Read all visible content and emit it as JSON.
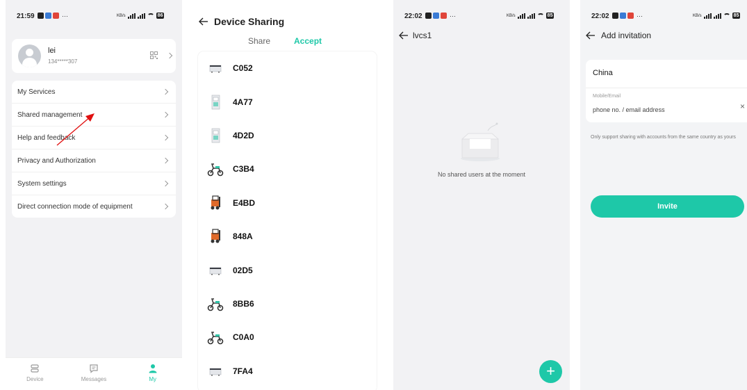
{
  "screen1": {
    "status": {
      "time": "21:59",
      "right_info": "79.8 KB/s",
      "battery": "86"
    },
    "profile": {
      "name": "lei",
      "phone": "134*****307"
    },
    "menu": [
      {
        "label": "My Services"
      },
      {
        "label": "Shared management"
      },
      {
        "label": "Help and feedback"
      },
      {
        "label": "Privacy and Authorization"
      },
      {
        "label": "System settings"
      },
      {
        "label": "Direct connection mode of equipment"
      }
    ],
    "tabs": [
      {
        "label": "Device",
        "icon": "device-icon"
      },
      {
        "label": "Messages",
        "icon": "message-icon"
      },
      {
        "label": "My",
        "icon": "person-icon"
      }
    ],
    "accent": "#1ec8a8",
    "annotation_color": "#e01010"
  },
  "screen2": {
    "title": "Device Sharing",
    "tabs": {
      "share": "Share",
      "accept": "Accept"
    },
    "devices": [
      {
        "name": "C052",
        "icon": "battery-unit-icon"
      },
      {
        "name": "4A77",
        "icon": "charging-cabinet-icon"
      },
      {
        "name": "4D2D",
        "icon": "charging-cabinet-icon"
      },
      {
        "name": "C3B4",
        "icon": "scooter-icon"
      },
      {
        "name": "E4BD",
        "icon": "forklift-icon"
      },
      {
        "name": "848A",
        "icon": "forklift-icon"
      },
      {
        "name": "02D5",
        "icon": "battery-unit-icon"
      },
      {
        "name": "8BB6",
        "icon": "scooter-icon"
      },
      {
        "name": "C0A0",
        "icon": "scooter-icon"
      },
      {
        "name": "7FA4",
        "icon": "battery-unit-icon"
      }
    ]
  },
  "screen3": {
    "status": {
      "time": "22:02",
      "battery": "85"
    },
    "title": "lvcs1",
    "empty_text": "No shared users at the moment",
    "fab_label": "+"
  },
  "screen4": {
    "status": {
      "time": "22:02",
      "battery": "85"
    },
    "title": "Add invitation",
    "country": "China",
    "field_label": "Mobile/Email",
    "field_placeholder": "phone no. / email address",
    "clear_label": "×",
    "hint": "Only support sharing with accounts from the same country as yours",
    "invite_label": "Invite"
  }
}
